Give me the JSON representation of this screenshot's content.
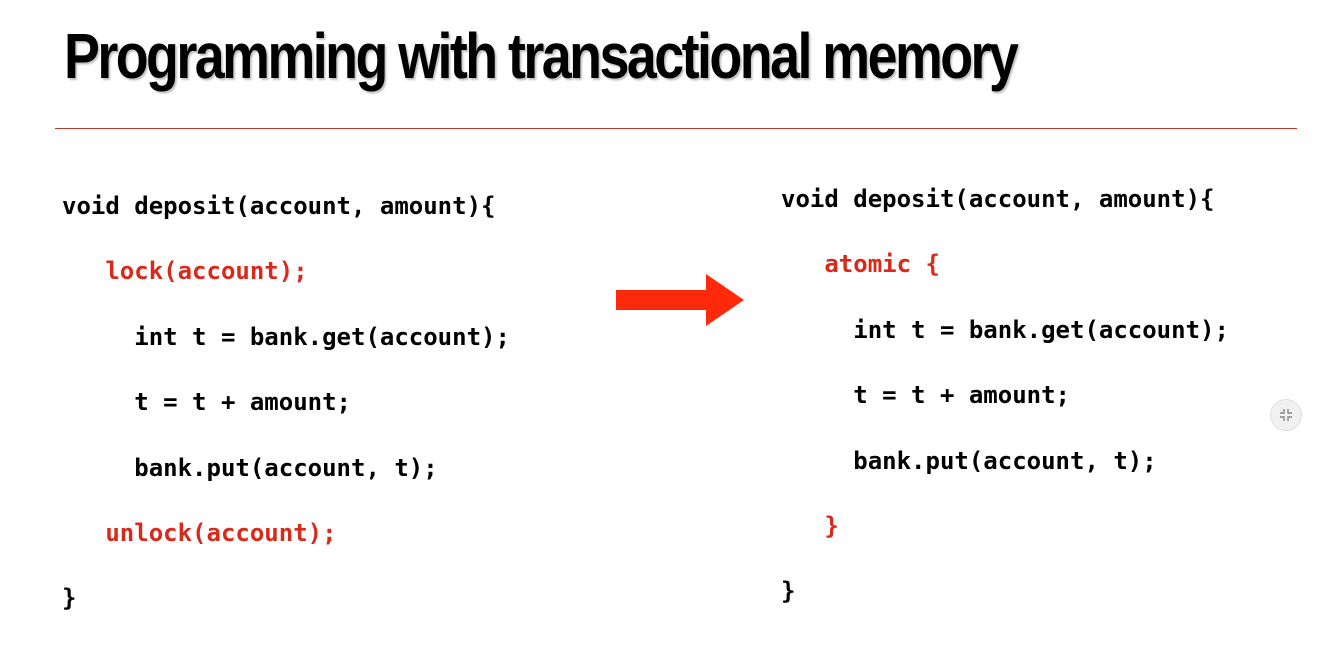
{
  "slide": {
    "title": "Programming with transactional memory"
  },
  "left_code": {
    "lines": [
      {
        "indent": "",
        "text": "void deposit(account, amount){",
        "color": "black"
      },
      {
        "indent": "   ",
        "text": "lock(account);",
        "color": "red"
      },
      {
        "indent": "     ",
        "text": "int t = bank.get(account);",
        "color": "black"
      },
      {
        "indent": "     ",
        "text": "t = t + amount;",
        "color": "black"
      },
      {
        "indent": "     ",
        "text": "bank.put(account, t);",
        "color": "black"
      },
      {
        "indent": "   ",
        "text": "unlock(account);",
        "color": "red"
      },
      {
        "indent": "",
        "text": "}",
        "color": "black"
      }
    ]
  },
  "right_code": {
    "lines": [
      {
        "indent": "",
        "text": "void deposit(account, amount){",
        "color": "black"
      },
      {
        "indent": "   ",
        "text": "atomic {",
        "color": "red"
      },
      {
        "indent": "     ",
        "text": "int t = bank.get(account);",
        "color": "black"
      },
      {
        "indent": "     ",
        "text": "t = t + amount;",
        "color": "black"
      },
      {
        "indent": "     ",
        "text": "bank.put(account, t);",
        "color": "black"
      },
      {
        "indent": "   ",
        "text": "}",
        "color": "red"
      },
      {
        "indent": "",
        "text": "}",
        "color": "black"
      }
    ]
  },
  "arrow": {
    "icon": "right-arrow-icon",
    "color": "#ff2a0c"
  },
  "colors": {
    "title": "#000000",
    "rule": "#c0392b",
    "code_black": "#000000",
    "code_red": "#d9291b"
  },
  "controls": {
    "exit_fullscreen_icon": "collapse-icon"
  }
}
